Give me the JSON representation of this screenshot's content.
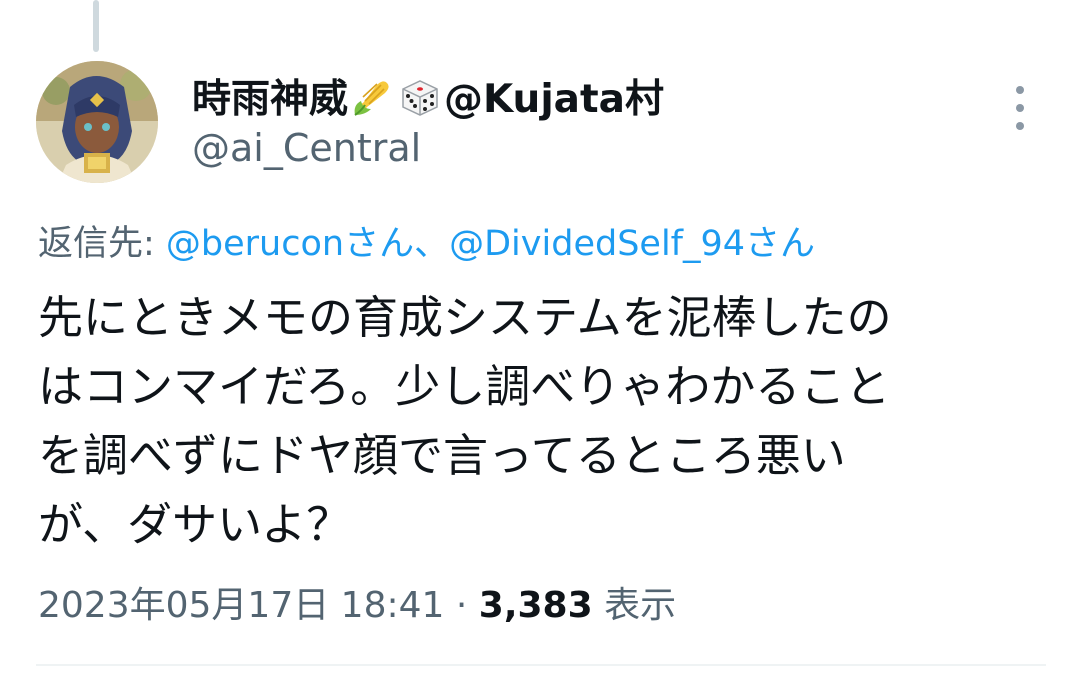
{
  "tweet": {
    "display_name": "時雨神威",
    "name_emoji_1": "corn-emoji",
    "name_emoji_2": "dice-emoji",
    "name_suffix": "@Kujata村",
    "handle": "@ai_Central",
    "reply_prefix": "返信先: ",
    "reply_mention_1": "@beruconさん",
    "reply_separator": "、",
    "reply_mention_2": "@DividedSelf_94さん",
    "text_lines": [
      "先にときメモの育成システムを泥棒したの",
      "はコンマイだろ。少し調べりゃわかること",
      "を調べずにドヤ顔で言ってるところ悪い",
      "が、ダサいよ？"
    ],
    "timestamp": "2023年05月17日 18:41",
    "meta_separator": " · ",
    "views_count": "3,383",
    "views_label": " 表示"
  },
  "colors": {
    "text": "#0f1419",
    "secondary": "#536471",
    "link": "#1d9bf0",
    "thread_line": "#cfd9de",
    "divider": "#eff3f4"
  },
  "icons": {
    "more": "more-vertical-icon"
  }
}
